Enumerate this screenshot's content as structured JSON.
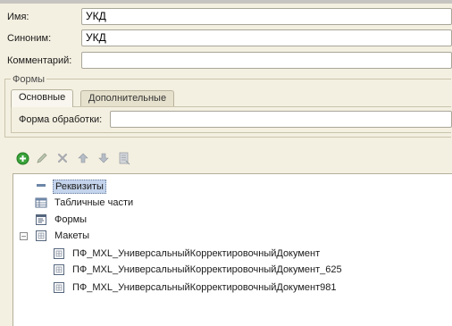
{
  "fields": {
    "name_label": "Имя:",
    "name_value": "УКД",
    "synonym_label": "Синоним:",
    "synonym_value": "УКД",
    "comment_label": "Комментарий:",
    "comment_value": ""
  },
  "forms_group": {
    "title": "Формы",
    "tabs": [
      {
        "label": "Основные",
        "active": true
      },
      {
        "label": "Дополнительные",
        "active": false
      }
    ],
    "processing_form_label": "Форма обработки:",
    "processing_form_value": ""
  },
  "toolbar": {
    "icons": [
      "add-icon",
      "edit-icon",
      "delete-icon",
      "move-up-icon",
      "move-down-icon",
      "sort-icon"
    ]
  },
  "tree": {
    "items": [
      {
        "label": "Реквизиты",
        "icon": "attributes-icon",
        "selected": true
      },
      {
        "label": "Табличные части",
        "icon": "table-parts-icon"
      },
      {
        "label": "Формы",
        "icon": "forms-icon"
      },
      {
        "label": "Макеты",
        "icon": "templates-icon",
        "expanded": true,
        "children": [
          {
            "label": "ПФ_MXL_УниверсальныйКорректировочныйДокумент"
          },
          {
            "label": "ПФ_MXL_УниверсальныйКорректировочныйДокумент_625"
          },
          {
            "label": "ПФ_MXL_УниверсальныйКорректировочныйДокумент981"
          }
        ]
      }
    ]
  },
  "colors": {
    "background": "#f4f0e1",
    "selection": "#c4d4ec",
    "add_icon_green": "#3aa33a"
  }
}
